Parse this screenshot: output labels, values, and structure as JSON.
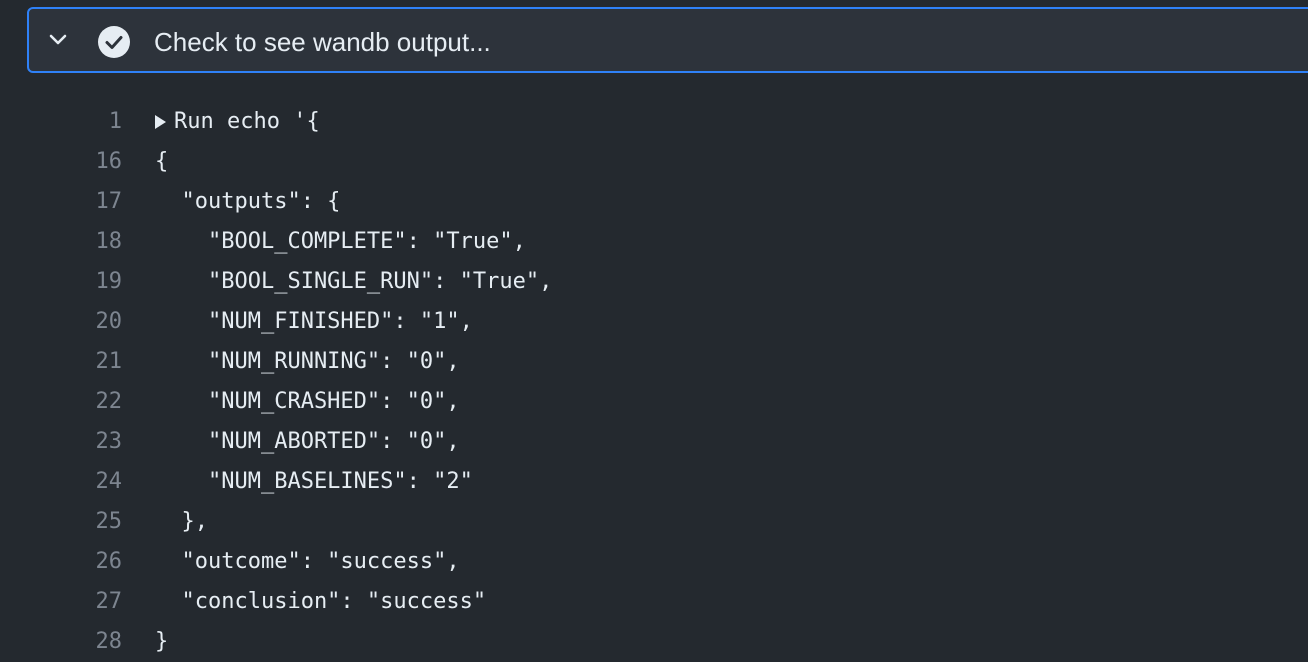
{
  "step": {
    "title": "Check to see wandb output...",
    "status_icon": "check-circle-icon",
    "expand_icon": "chevron-down-icon",
    "accent_color": "#2f81f7"
  },
  "log": {
    "lines": [
      {
        "number": "1",
        "text": "Run echo '{",
        "collapsible": true
      },
      {
        "number": "16",
        "text": "{"
      },
      {
        "number": "17",
        "text": "  \"outputs\": {"
      },
      {
        "number": "18",
        "text": "    \"BOOL_COMPLETE\": \"True\","
      },
      {
        "number": "19",
        "text": "    \"BOOL_SINGLE_RUN\": \"True\","
      },
      {
        "number": "20",
        "text": "    \"NUM_FINISHED\": \"1\","
      },
      {
        "number": "21",
        "text": "    \"NUM_RUNNING\": \"0\","
      },
      {
        "number": "22",
        "text": "    \"NUM_CRASHED\": \"0\","
      },
      {
        "number": "23",
        "text": "    \"NUM_ABORTED\": \"0\","
      },
      {
        "number": "24",
        "text": "    \"NUM_BASELINES\": \"2\""
      },
      {
        "number": "25",
        "text": "  },"
      },
      {
        "number": "26",
        "text": "  \"outcome\": \"success\","
      },
      {
        "number": "27",
        "text": "  \"conclusion\": \"success\""
      },
      {
        "number": "28",
        "text": "}"
      }
    ]
  }
}
